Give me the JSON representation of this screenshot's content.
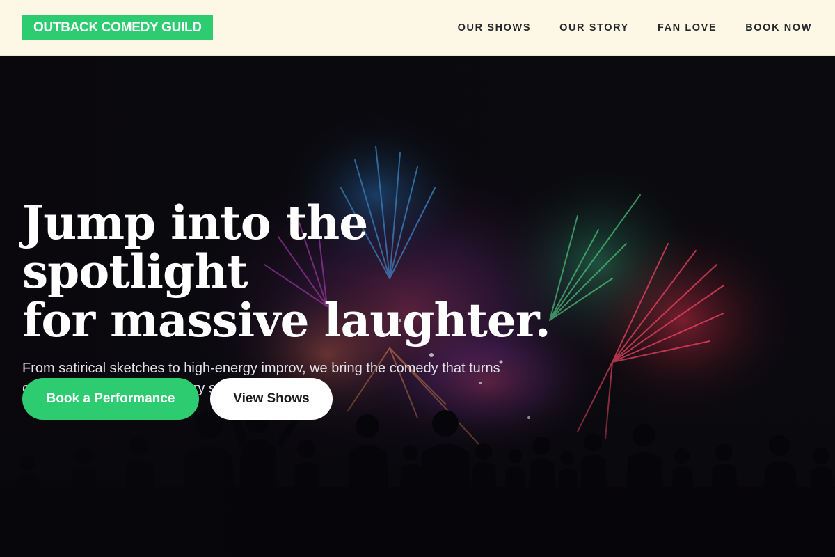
{
  "header": {
    "logo": "OUTBACK COMEDY GUILD",
    "nav": [
      {
        "label": "OUR SHOWS"
      },
      {
        "label": "OUR STORY"
      },
      {
        "label": "FAN LOVE"
      },
      {
        "label": "BOOK NOW"
      }
    ]
  },
  "hero": {
    "title_line1": "Jump into the spotlight",
    "title_line2": "for massive laughter.",
    "subtitle": "From satirical sketches to high-energy improv, we bring the comedy that turns ordinary nights into legendary stories.",
    "primary_button": "Book a Performance",
    "secondary_button": "View Shows",
    "image": "fireworks-crowd-silhouette"
  },
  "colors": {
    "accent": "#2ecc71",
    "header_bg": "#fdf8e6",
    "hero_bg": "#0b0a0f",
    "text_dark": "#26272b"
  }
}
